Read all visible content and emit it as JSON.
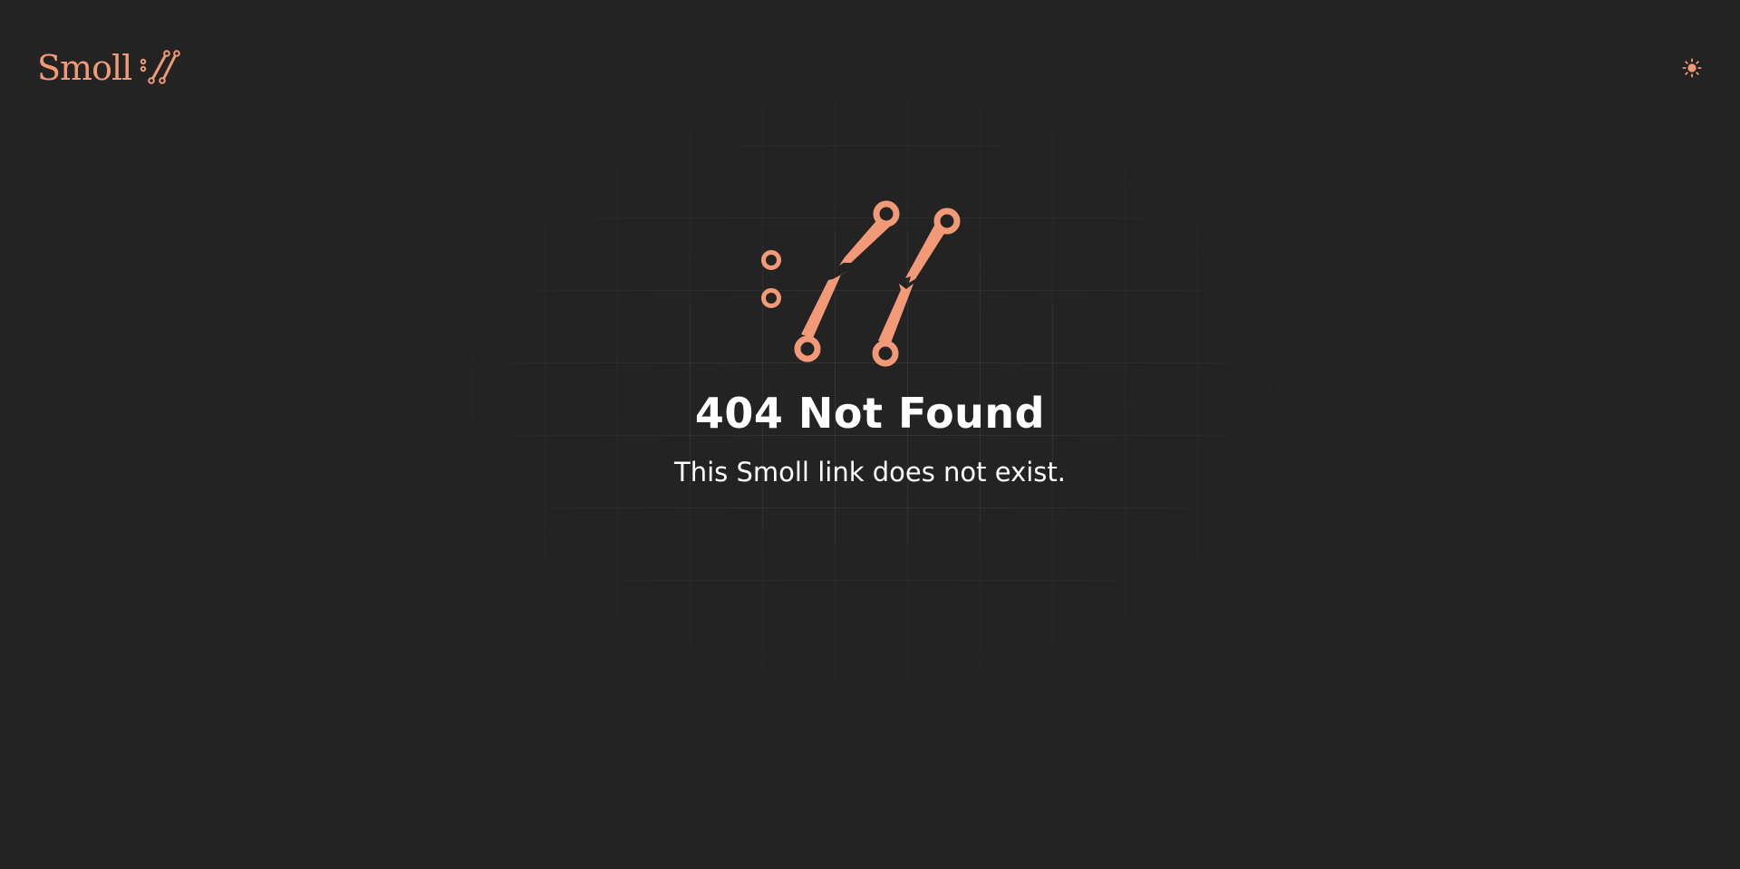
{
  "brand": {
    "name": "Smoll",
    "accent_color": "#f29a78",
    "logo_icon": "broken-link-slashes-icon"
  },
  "header": {
    "theme_toggle_icon": "sun-icon",
    "theme_toggle_label": "Toggle theme"
  },
  "error": {
    "icon": "broken-link-icon",
    "title": "404 Not Found",
    "message": "This Smoll link does not exist."
  },
  "colors": {
    "background": "#232323",
    "text": "#ffffff",
    "accent": "#f29a78"
  }
}
